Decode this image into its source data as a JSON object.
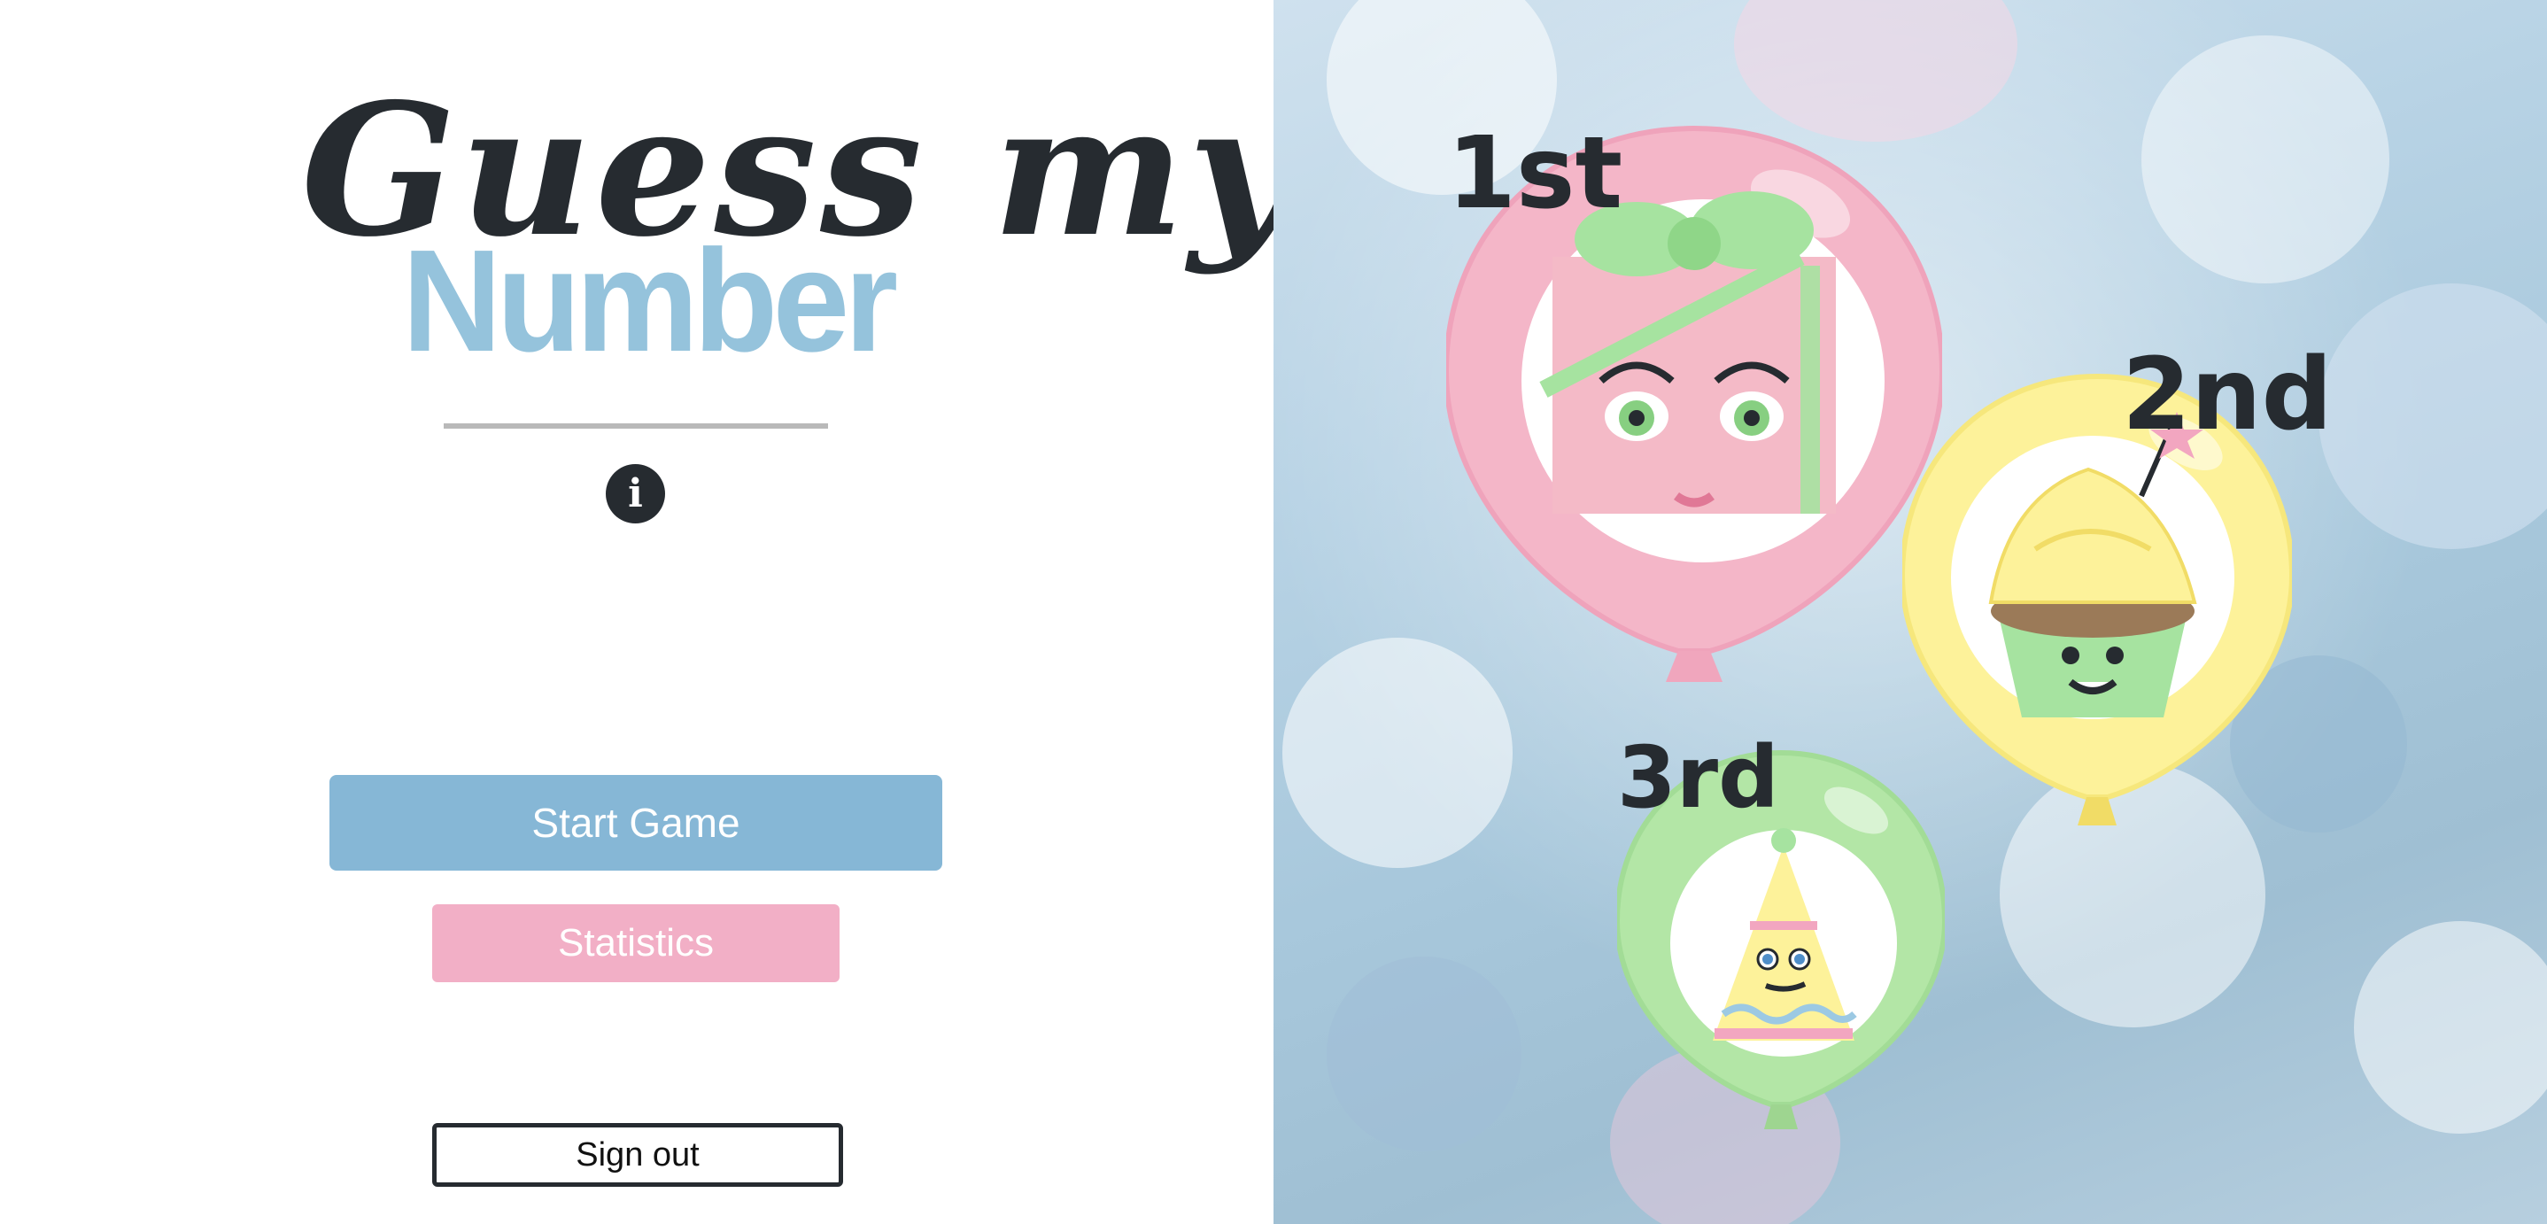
{
  "game": {
    "title_line1": "Guess my",
    "title_line2": "Number"
  },
  "buttons": {
    "info_glyph": "i",
    "start_label": "Start Game",
    "stats_label": "Statistics",
    "signout_label": "Sign out"
  },
  "podium": {
    "first_label": "1st",
    "second_label": "2nd",
    "third_label": "3rd"
  },
  "colors": {
    "dark": "#262b30",
    "title_blue": "#95c3dc",
    "start_button": "#86b7d6",
    "stats_button": "#f2afc6",
    "balloon_pink": "#f4b6c8",
    "balloon_yellow": "#fdf29a",
    "balloon_green": "#b3e6a6"
  },
  "icons": {
    "info": "info-icon",
    "first_place_character": "gift-box-character-icon",
    "second_place_character": "cupcake-character-icon",
    "third_place_character": "party-hat-character-icon"
  }
}
